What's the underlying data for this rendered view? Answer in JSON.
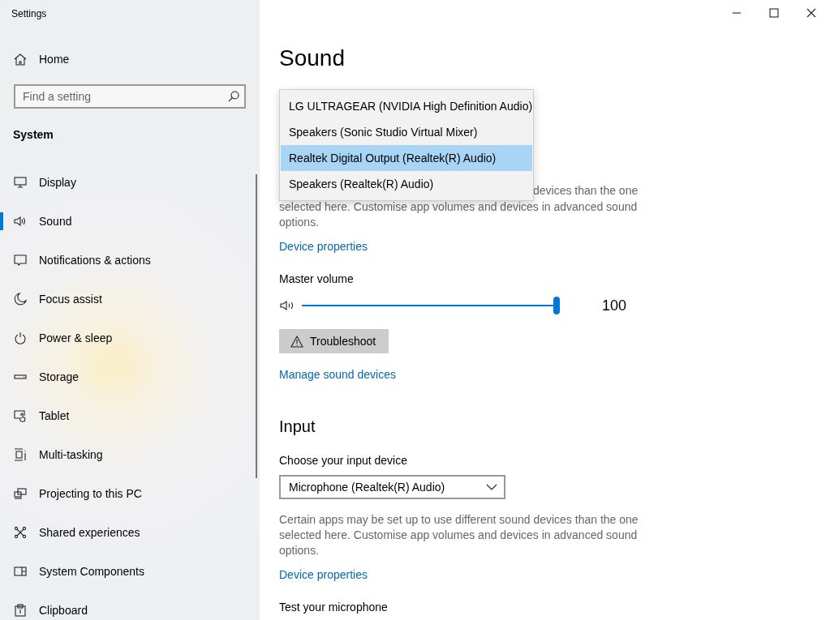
{
  "window": {
    "title": "Settings"
  },
  "sidebar": {
    "home": "Home",
    "search": {
      "placeholder": "Find a setting"
    },
    "section": "System",
    "items": [
      {
        "label": "Display",
        "kind": "display",
        "selected": false
      },
      {
        "label": "Sound",
        "kind": "sound",
        "selected": true
      },
      {
        "label": "Notifications & actions",
        "kind": "notifications",
        "selected": false
      },
      {
        "label": "Focus assist",
        "kind": "focus",
        "selected": false
      },
      {
        "label": "Power & sleep",
        "kind": "power",
        "selected": false
      },
      {
        "label": "Storage",
        "kind": "storage",
        "selected": false
      },
      {
        "label": "Tablet",
        "kind": "tablet",
        "selected": false
      },
      {
        "label": "Multi-tasking",
        "kind": "multitasking",
        "selected": false
      },
      {
        "label": "Projecting to this PC",
        "kind": "projecting",
        "selected": false
      },
      {
        "label": "Shared experiences",
        "kind": "shared",
        "selected": false
      },
      {
        "label": "System Components",
        "kind": "components",
        "selected": false
      },
      {
        "label": "Clipboard",
        "kind": "clipboard",
        "selected": false
      }
    ]
  },
  "page": {
    "title": "Sound",
    "output": {
      "device_menu": [
        {
          "label": "LG ULTRAGEAR (NVIDIA High Definition Audio)",
          "selected": false
        },
        {
          "label": "Speakers (Sonic Studio Virtual Mixer)",
          "selected": false
        },
        {
          "label": "Realtek Digital Output (Realtek(R) Audio)",
          "selected": true
        },
        {
          "label": "Speakers (Realtek(R) Audio)",
          "selected": false
        }
      ],
      "description_lines": [
        "devices than the one",
        "selected here. Customise app volumes and devices in advanced sound",
        "options."
      ],
      "link": "Device properties",
      "volume_label": "Master volume",
      "volume": {
        "level": 1.0,
        "reading": "100"
      },
      "troubleshoot": "Troubleshoot",
      "manage_link": "Manage sound devices"
    },
    "input": {
      "heading": "Input",
      "label": "Choose your input device",
      "device": "Microphone (Realtek(R) Audio)",
      "description_lines": [
        "Certain apps may be set up to use different sound devices than the one",
        "selected here. Customise app volumes and devices in advanced sound",
        "options."
      ],
      "link": "Device properties",
      "test_label": "Test your microphone"
    }
  }
}
